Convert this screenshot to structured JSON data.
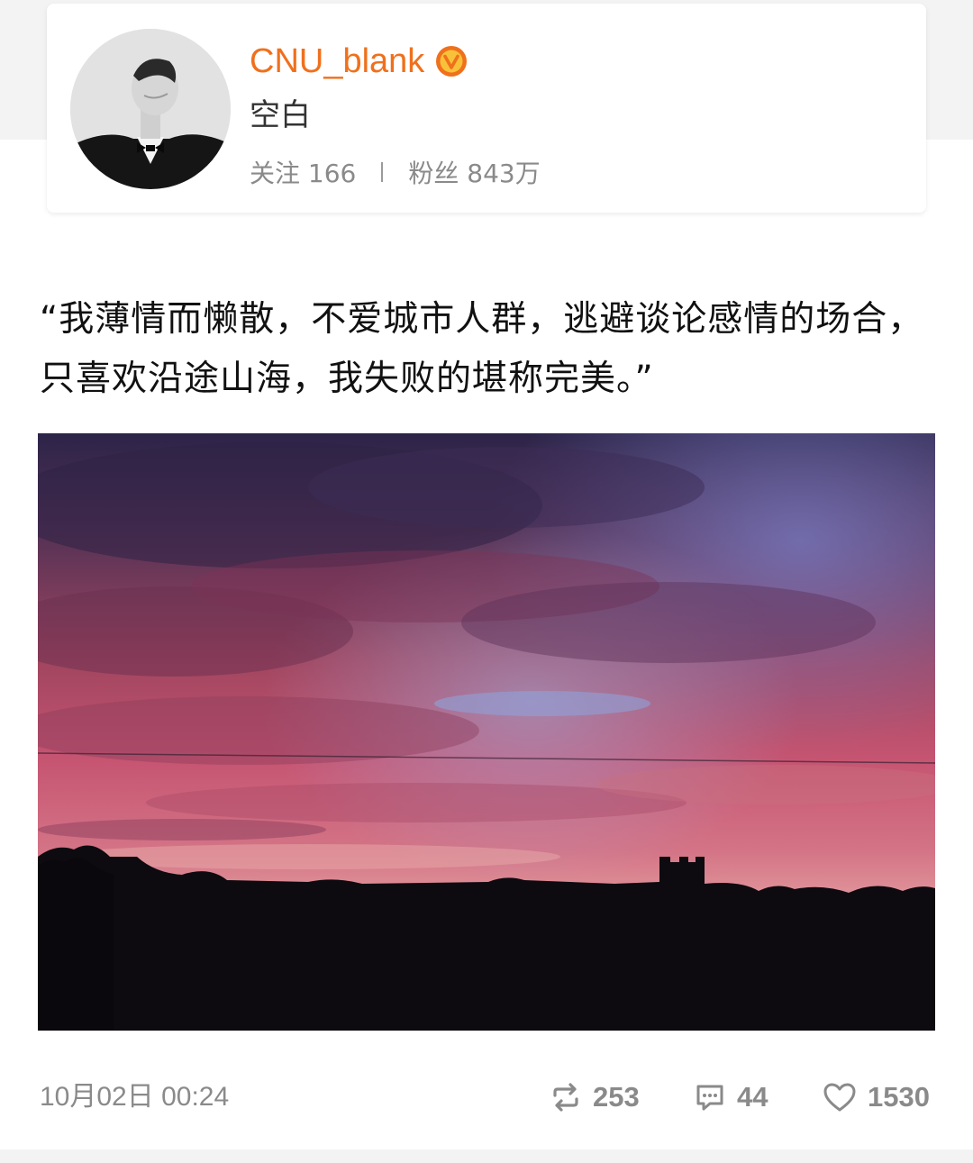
{
  "profile": {
    "username": "CNU_blank",
    "nickname": "空白",
    "following_label": "关注",
    "following_count": "166",
    "followers_label": "粉丝",
    "followers_count": "843万",
    "verified_icon": "verified-badge-icon",
    "accent_color": "#f0701c"
  },
  "post": {
    "text": "“我薄情而懒散，不爱城市人群，逃避谈论感情的场合，只喜欢沿途山海，我失败的堪称完美。”",
    "timestamp": "10月02日 00:24",
    "reposts": "253",
    "comments": "44",
    "likes": "1530"
  },
  "icons": {
    "repost": "repost-icon",
    "comment": "comment-icon",
    "like": "heart-icon"
  }
}
